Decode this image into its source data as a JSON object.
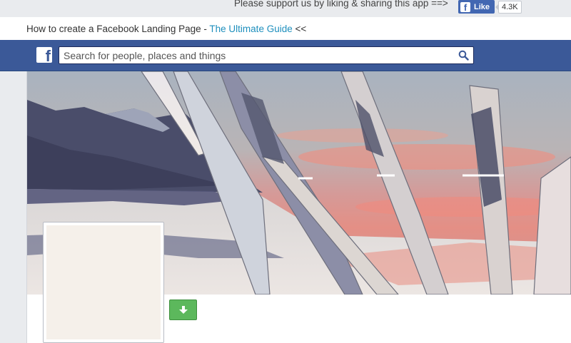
{
  "support": {
    "text": "Please support us by liking & sharing this app ==>",
    "like_label": "Like",
    "like_count": "4.3K"
  },
  "howto": {
    "prefix": "How to create a Facebook Landing Page - ",
    "link": "The Ultimate Guide",
    "suffix": " <<"
  },
  "header": {
    "logo": "f",
    "search_placeholder": "Search for people, places and things"
  },
  "colors": {
    "facebook_blue": "#3b5998",
    "link_blue": "#1e8fbd",
    "download_green": "#5cb85c"
  },
  "icons": {
    "logo": "facebook-logo-icon",
    "search": "search-icon",
    "download": "download-arrow-icon"
  }
}
